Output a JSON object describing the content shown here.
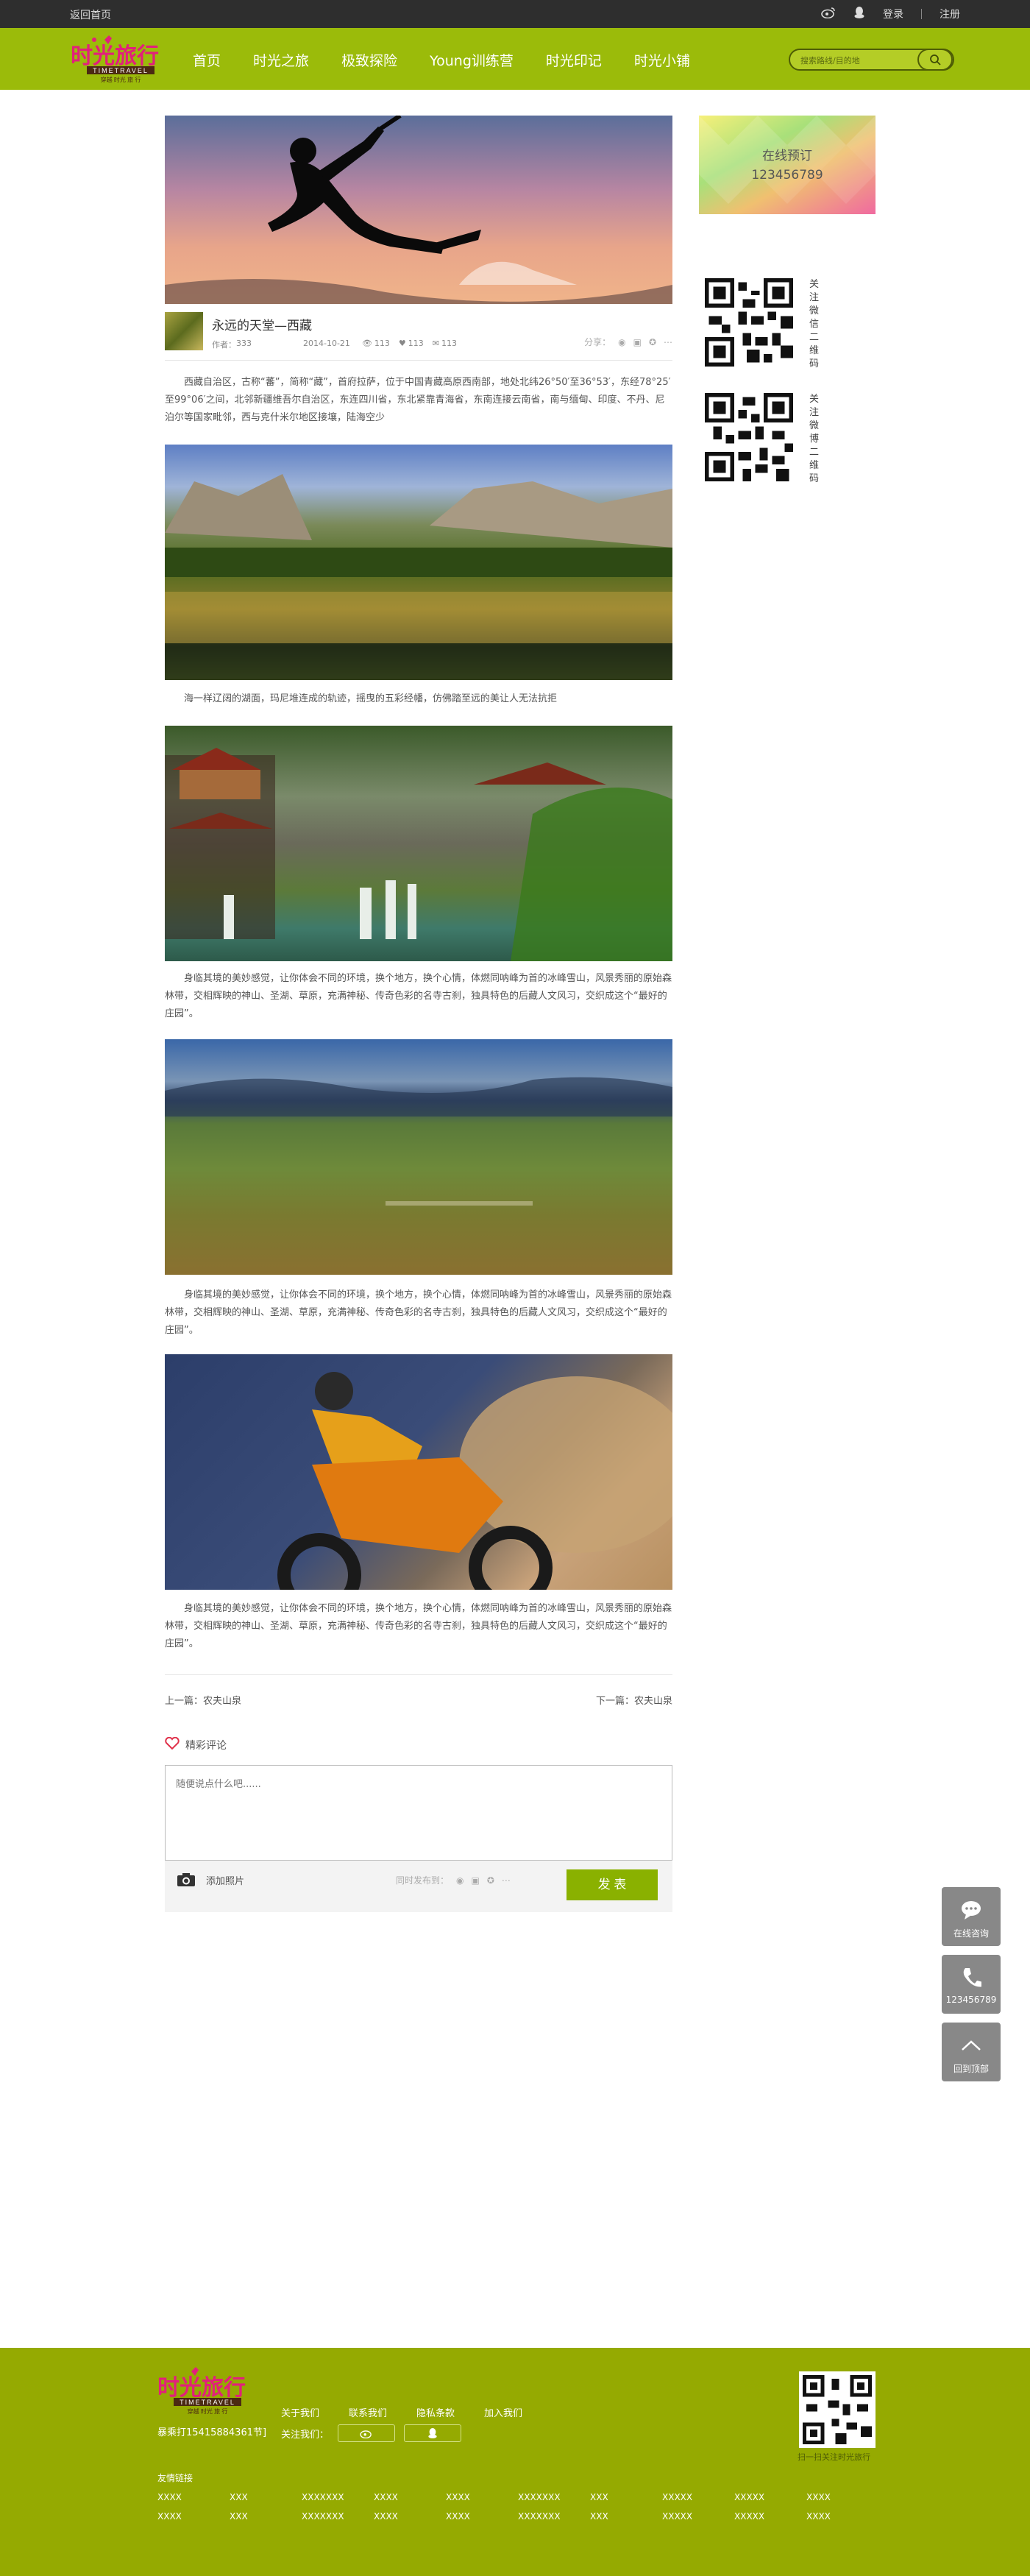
{
  "topbar": {
    "back_home": "返回首页",
    "login": "登录",
    "register": "注册",
    "icons": [
      "weibo-icon",
      "qq-icon"
    ]
  },
  "nav": {
    "logo_text": "时光旅行",
    "logo_sub": "TIMETRAVEL",
    "logo_tagline": "穿越 时光 旅 行",
    "items": [
      "首页",
      "时光之旅",
      "极致探险",
      "Young训练营",
      "时光印记",
      "时光小铺"
    ],
    "search_placeholder": "搜索路线/目的地"
  },
  "article": {
    "title": "永远的天堂—西藏",
    "author_label": "作者：",
    "author": "333",
    "date": "2014-10-21",
    "views": "113",
    "likes": "113",
    "comments": "113",
    "share_label": "分享：",
    "para1": "西藏自治区，古称“蕃”，简称“藏”，首府拉萨，位于中国青藏高原西南部，地处北纬26°50′至36°53′，东经78°25′至99°06′之间，北邻新疆维吾尔自治区，东连四川省，东北紧靠青海省，东南连接云南省，南与缅甸、印度、不丹、尼泊尔等国家毗邻，西与克什米尔地区接壤，陆海空少",
    "caption1": "海一样辽阔的湖面，玛尼堆连成的轨迹，摇曳的五彩经幡，仿佛踏至远的美让人无法抗拒",
    "para2": "身临其境的美妙感觉，让你体会不同的环境，换个地方，换个心情，体燃同呐峰为首的冰峰雪山，风景秀丽的原始森林带，交相辉映的神山、圣湖、草原，充满神秘、传奇色彩的名寺古刹，独具特色的后藏人文风习，交织成这个“最好的庄园”。",
    "para3": "身临其境的美妙感觉，让你体会不同的环境，换个地方，换个心情，体燃同呐峰为首的冰峰雪山，风景秀丽的原始森林带，交相辉映的神山、圣湖、草原，充满神秘、传奇色彩的名寺古刹，独具特色的后藏人文风习，交织成这个“最好的庄园”。",
    "para4": "身临其境的美妙感觉，让你体会不同的环境，换个地方，换个心情，体燃同呐峰为首的冰峰雪山，风景秀丽的原始森林带，交相辉映的神山、圣湖、草原，充满神秘、传奇色彩的名寺古刹，独具特色的后藏人文风习，交织成这个“最好的庄园”。",
    "prev": "上一篇：农夫山泉",
    "next": "下一篇：农夫山泉"
  },
  "comments": {
    "title": "精彩评论",
    "placeholder": "随便说点什么吧......",
    "add_photo": "添加照片",
    "sync_label": "同时发布到：",
    "publish": "发 表"
  },
  "sidebar": {
    "booking_line1": "在线预订",
    "booking_line2": "123456789",
    "qr1_label": "关注微信二维码",
    "qr2_label": "关注微博二维码"
  },
  "float": {
    "consult": "在线咨询",
    "phone": "123456789",
    "top": "回到顶部"
  },
  "footer": {
    "phone": "暴乘打15415884361节]",
    "links": [
      "关于我们",
      "联系我们",
      "隐私条款",
      "加入我们"
    ],
    "follow_label": "关注我们：",
    "qr_label": "扫一扫关注时光旅行",
    "friends_title": "友情链接",
    "friends_row1": [
      "XXXX",
      "XXX",
      "XXXXXXX",
      "XXXX",
      "XXXX",
      "XXXXXXX",
      "XXX",
      "XXXXX",
      "XXXXX",
      "XXXX"
    ],
    "friends_row2": [
      "XXXX",
      "XXX",
      "XXXXXXX",
      "XXXX",
      "XXXX",
      "XXXXXXX",
      "XXX",
      "XXXXX",
      "XXXXX",
      "XXXX"
    ]
  },
  "colors": {
    "brand_green": "#9bbb0a",
    "footer_green": "#95aa01",
    "topbar": "#2e2e2e",
    "publish": "#8ab100"
  }
}
